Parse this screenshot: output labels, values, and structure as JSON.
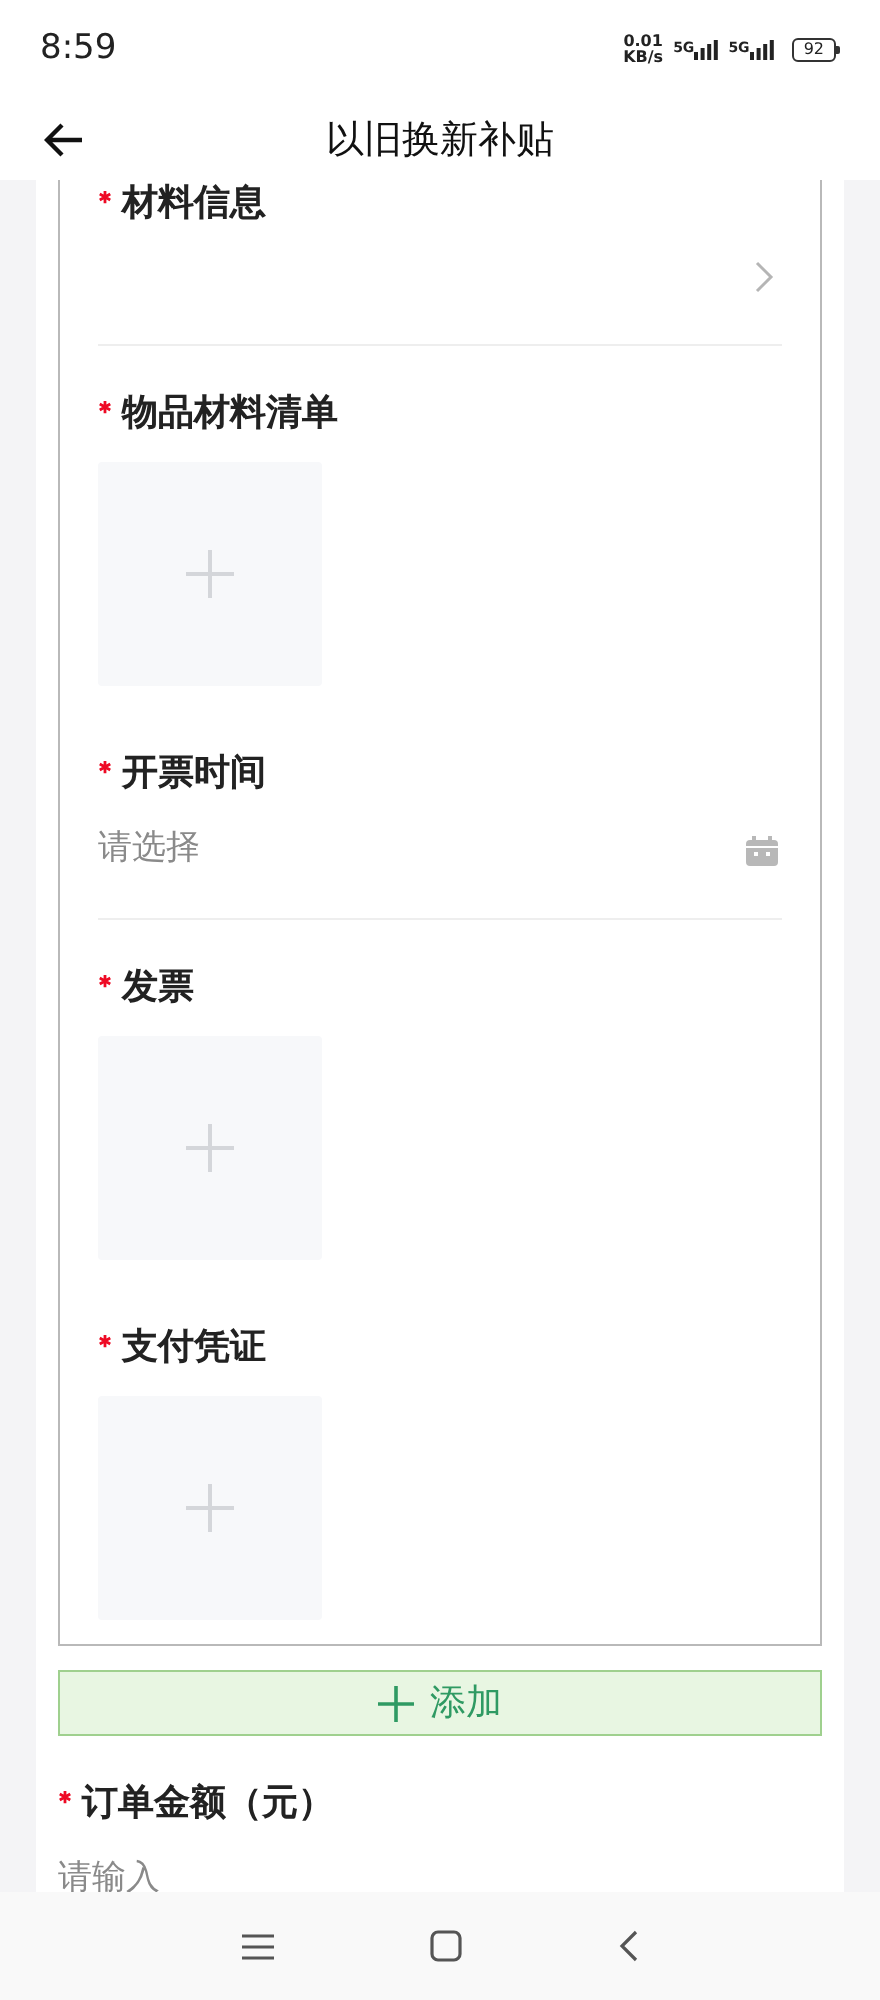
{
  "status_bar": {
    "time": "8:59",
    "network_speed": "0.01",
    "speed_unit": "KB/s",
    "signal_labels": [
      "5G",
      "5G"
    ],
    "battery": "92"
  },
  "header": {
    "title": "以旧换新补贴"
  },
  "fields": [
    {
      "kind": "select",
      "label": "材料信息",
      "required": true
    },
    {
      "kind": "upload",
      "label": "物品材料清单",
      "required": true
    },
    {
      "kind": "date",
      "label": "开票时间",
      "required": true,
      "placeholder": "请选择"
    },
    {
      "kind": "upload",
      "label": "发票",
      "required": true
    },
    {
      "kind": "upload",
      "label": "支付凭证",
      "required": true
    }
  ],
  "add_button": {
    "label": "添加"
  },
  "amount_field": {
    "label": "订单金额（元）",
    "required": true,
    "placeholder": "请输入"
  }
}
